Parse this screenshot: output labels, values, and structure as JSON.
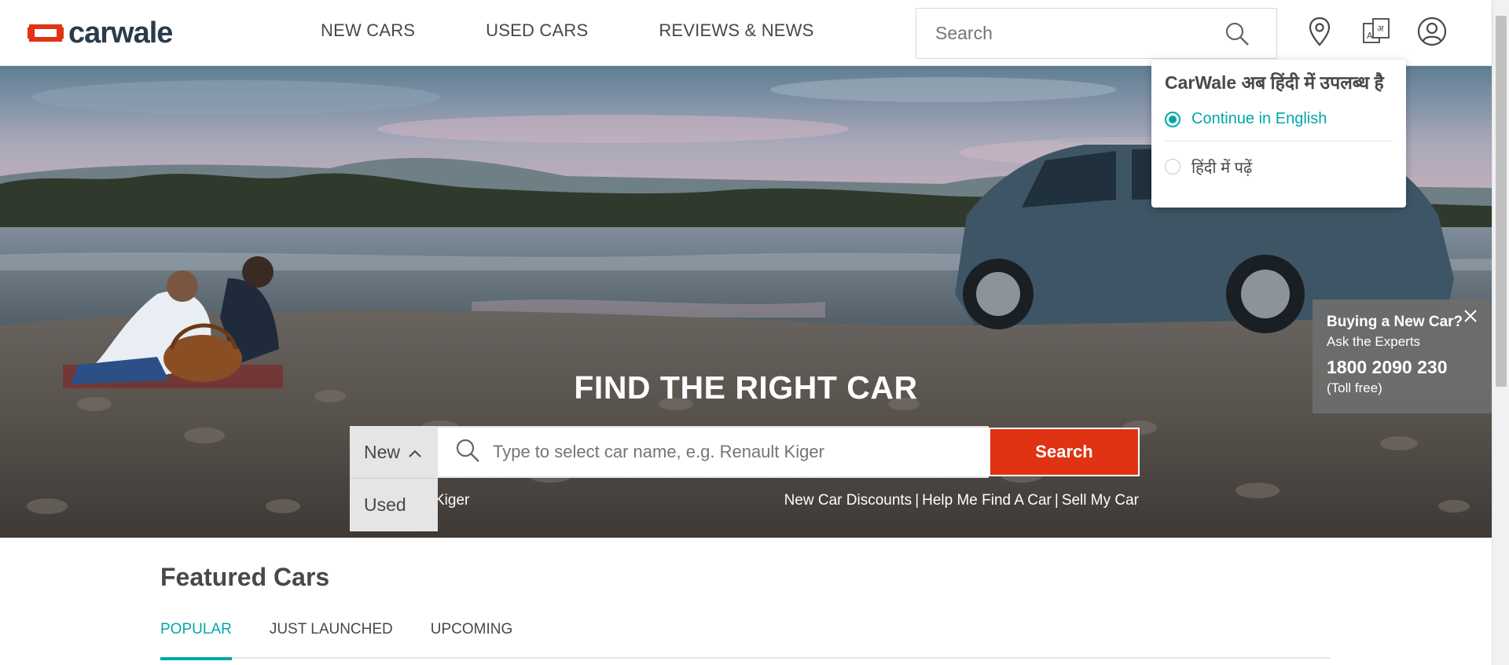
{
  "header": {
    "brand": "carwale",
    "nav": [
      "NEW CARS",
      "USED CARS",
      "REVIEWS & NEWS"
    ],
    "search_placeholder": "Search",
    "icons": [
      "location-pin-icon",
      "language-translate-icon",
      "user-account-icon"
    ]
  },
  "language_popup": {
    "title": "CarWale अब हिंदी में उपलब्ध है",
    "option_english": "Continue in English",
    "option_hindi": "हिंदी में पढ़ें",
    "selected": "english"
  },
  "hero": {
    "title": "FIND THE RIGHT CAR",
    "type_selected": "New",
    "type_options": [
      "Used"
    ],
    "input_placeholder": "Type to select car name, e.g. Renault Kiger",
    "search_button": "Search",
    "left_link_partial": "Kiger",
    "quick_links": [
      "New Car Discounts",
      "Help Me Find A Car",
      "Sell My Car"
    ]
  },
  "expert_panel": {
    "heading": "Buying a New Car?",
    "subheading": "Ask the Experts",
    "phone": "1800 2090 230",
    "note": "(Toll free)"
  },
  "featured": {
    "title": "Featured Cars",
    "tabs": [
      "POPULAR",
      "JUST LAUNCHED",
      "UPCOMING"
    ],
    "active_tab": "POPULAR"
  },
  "colors": {
    "accent_teal": "#00a8a8",
    "search_red": "#e03314",
    "logo_red": "#e03314",
    "logo_navy": "#2a3b4c"
  }
}
